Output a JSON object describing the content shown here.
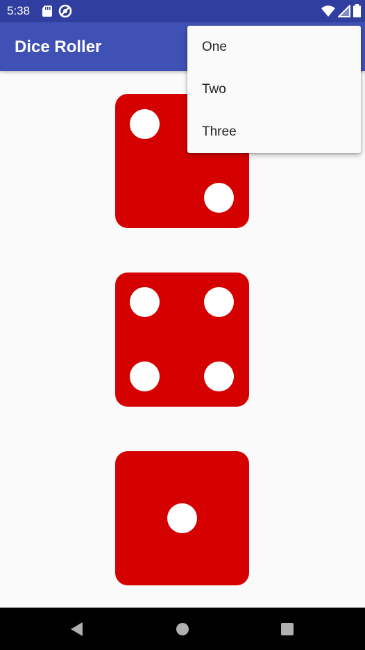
{
  "status_bar": {
    "time": "5:38",
    "left_icons": [
      "sd-card-icon",
      "sync-icon"
    ],
    "right_icons": [
      "wifi-icon",
      "signal-icon",
      "battery-icon"
    ],
    "background": "#303f9f"
  },
  "app_bar": {
    "title": "Dice Roller",
    "background": "#3f51b5"
  },
  "dice": {
    "color": "#d50000",
    "pip_color": "#ffffff",
    "values": [
      2,
      4,
      1
    ]
  },
  "menu": {
    "items": [
      {
        "label": "One"
      },
      {
        "label": "Two"
      },
      {
        "label": "Three"
      }
    ]
  },
  "nav_bar": {
    "buttons": [
      "back-icon",
      "home-icon",
      "recents-icon"
    ]
  }
}
